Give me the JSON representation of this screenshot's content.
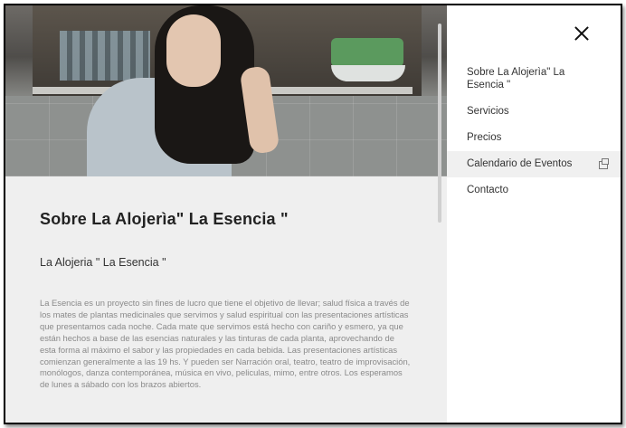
{
  "menu": {
    "items": [
      {
        "label": "Sobre La Alojerìa\" La Esencia \""
      },
      {
        "label": "Servicios"
      },
      {
        "label": "Precios"
      },
      {
        "label": "Calendario de Eventos"
      },
      {
        "label": "Contacto"
      }
    ],
    "close_icon": "close-icon",
    "external_icon": "external-link-icon"
  },
  "article": {
    "title": "Sobre La Alojerìa\" La Esencia \"",
    "subtitle": "La Alojeria \" La Esencia \"",
    "body": "La Esencia es un proyecto sin fines de lucro que tiene el objetivo de llevar; salud física a través de los mates de plantas medicinales que servimos y salud espiritual con las presentaciones artísticas que presentamos cada noche. Cada mate que servimos está hecho con cariño y esmero, ya que están hechos a base de las esencias naturales y las tinturas de cada planta, aprovechando de esta forma al máximo el sabor y las propiedades en cada bebida. Las presentaciones artísticas comienzan generalmente a las 19 hs. Y pueden ser Narración oral, teatro, teatro de improvisación, monólogos, danza contemporánea, música en vivo, peliculas, mimo, entre otros. Los esperamos de lunes a sábado con los brazos abiertos."
  }
}
